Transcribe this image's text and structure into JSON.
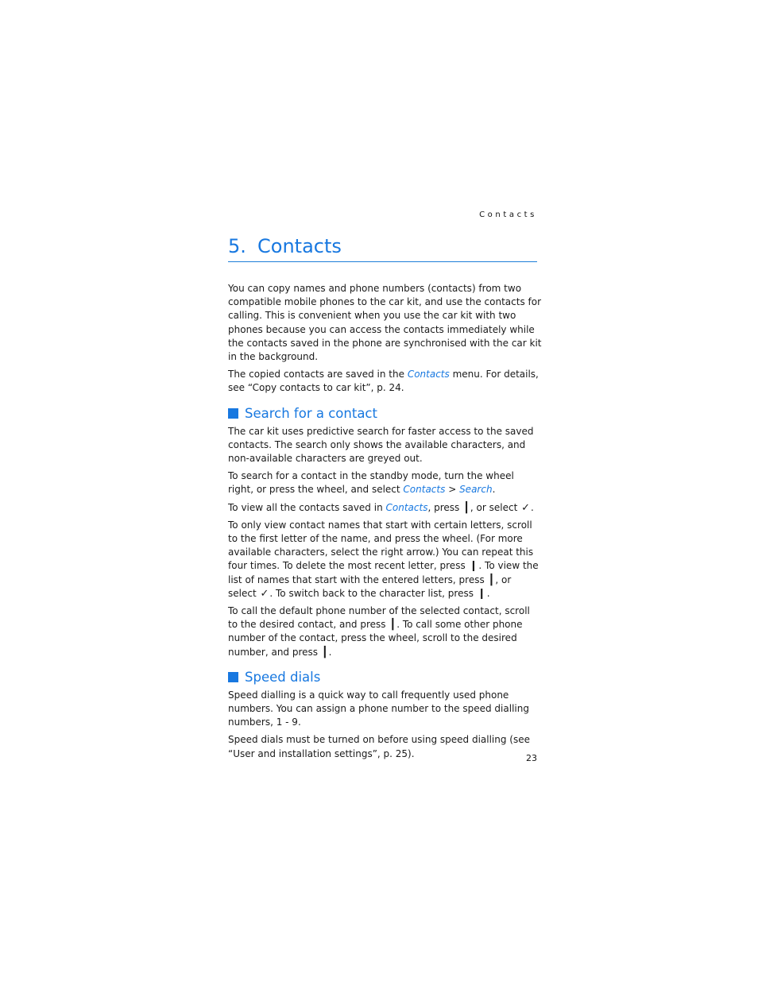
{
  "running_head": "Contacts",
  "chapter": {
    "number": "5.",
    "title": "Contacts"
  },
  "intro": {
    "p1": "You can copy names and phone numbers (contacts) from two compatible mobile phones to the car kit, and use the contacts for calling. This is convenient when you use the car kit with two phones because you can access the contacts immediately while the contacts saved in the phone are synchronised with the car kit in the background.",
    "p2_a": "The copied contacts are saved in the ",
    "p2_link": "Contacts",
    "p2_b": " menu. For details, see “Copy contacts to car kit”, p. 24."
  },
  "search": {
    "heading": "Search for a contact",
    "p1": "The car kit uses predictive search for faster access to the saved contacts. The search only shows the available characters, and non-available characters are greyed out.",
    "p2_a": "To search for a contact in the standby mode, turn the wheel right, or press the wheel, and select ",
    "p2_link1": "Contacts",
    "p2_sep": " > ",
    "p2_link2": "Search",
    "p2_end": ".",
    "p3_a": "To view all the contacts saved in ",
    "p3_link": "Contacts",
    "p3_b": ", press ",
    "p3_c": ", or select ",
    "p3_end": ".",
    "p4_a": "To only view contact names that start with certain letters, scroll to the first letter of the name, and press the wheel. (For more available characters, select the right arrow.) You can repeat this four times. To delete the most recent letter, press ",
    "p4_b": ". To view the list of names that start with the entered letters, press ",
    "p4_c": ", or select ",
    "p4_d": ". To switch back to the character list, press ",
    "p4_end": ".",
    "p5_a": "To call the default phone number of the selected contact, scroll to the desired contact, and press ",
    "p5_b": ". To call some other phone number of the contact, press the wheel, scroll to the desired number, and press ",
    "p5_end": "."
  },
  "icons": {
    "call_key": "┃",
    "end_key": "❙",
    "select_check": "✓"
  },
  "speed": {
    "heading": "Speed dials",
    "p1": "Speed dialling is a quick way to call frequently used phone numbers. You can assign a phone number to the speed dialling numbers, 1 - 9.",
    "p2": "Speed dials must be turned on before using speed dialling (see “User and installation settings”, p. 25)."
  },
  "page_number": "23"
}
